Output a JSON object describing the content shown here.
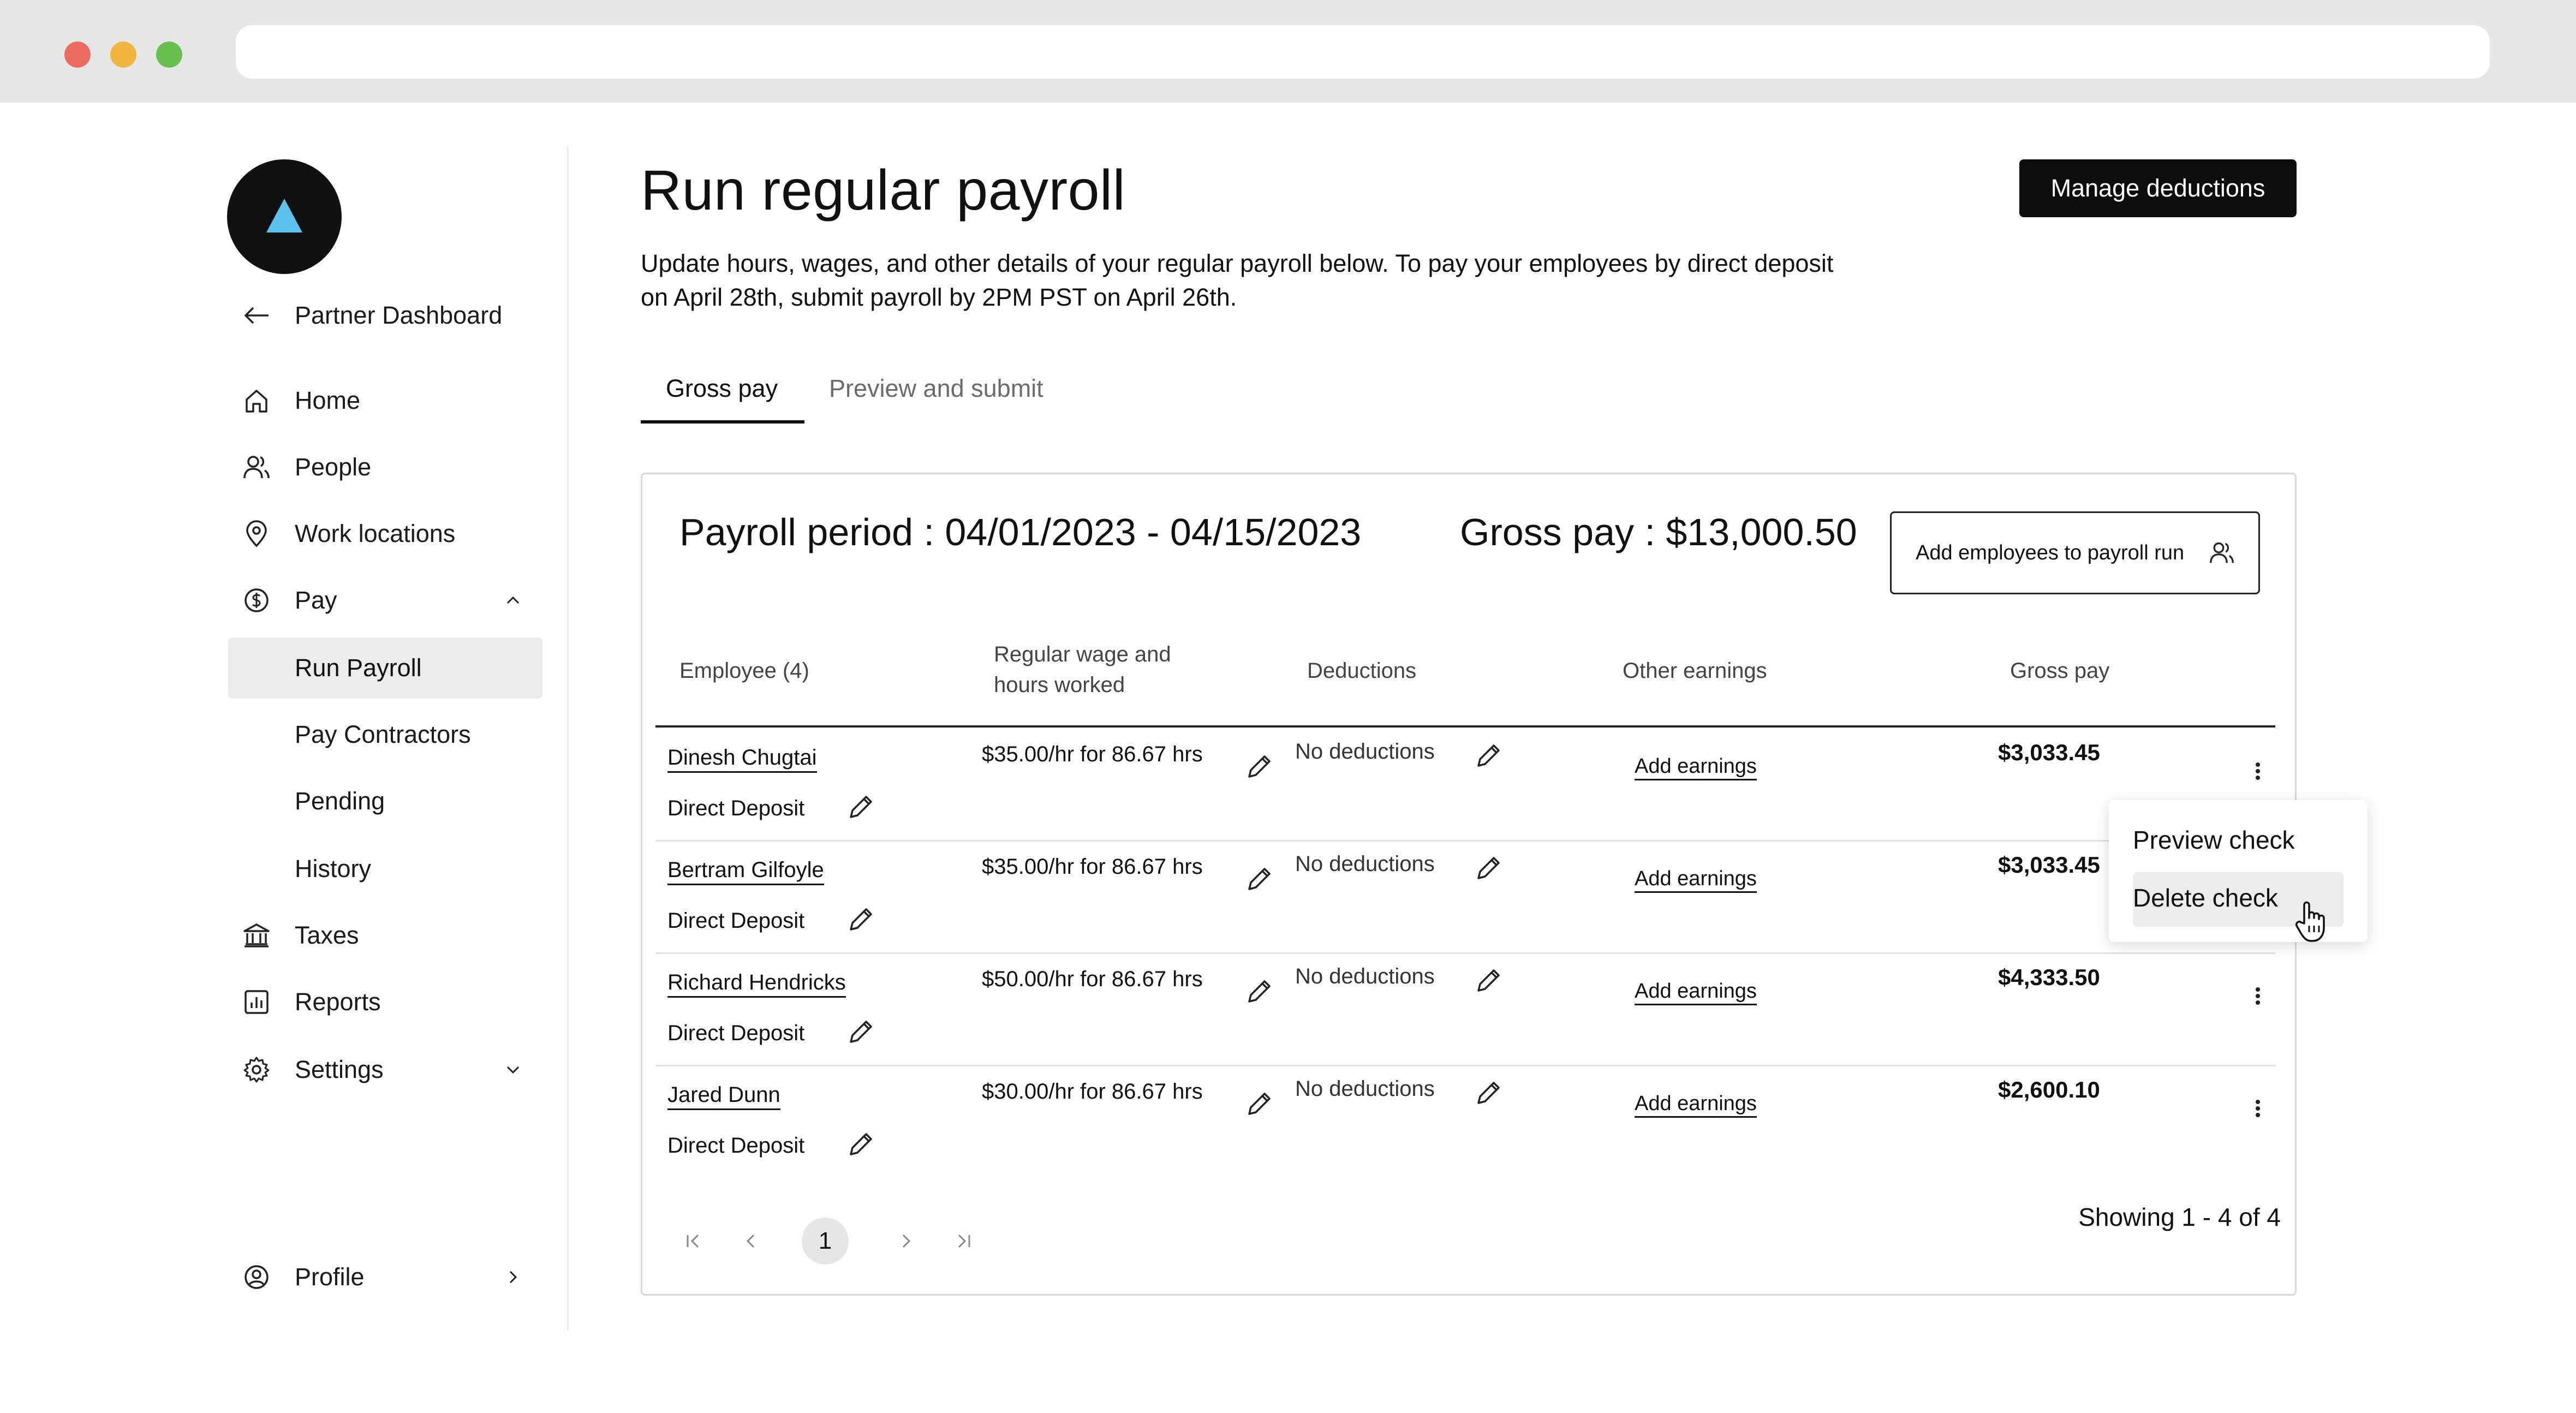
{
  "sidebar": {
    "back_link": "Partner Dashboard",
    "items": [
      {
        "label": "Home",
        "icon": "home-icon"
      },
      {
        "label": "People",
        "icon": "people-icon"
      },
      {
        "label": "Work locations",
        "icon": "location-pin-icon"
      },
      {
        "label": "Pay",
        "icon": "dollar-circle-icon"
      },
      {
        "label": "Run Payroll"
      },
      {
        "label": "Pay Contractors"
      },
      {
        "label": "Pending"
      },
      {
        "label": "History"
      },
      {
        "label": "Taxes",
        "icon": "bank-icon"
      },
      {
        "label": "Reports",
        "icon": "report-chart-icon"
      },
      {
        "label": "Settings",
        "icon": "gear-icon"
      }
    ],
    "profile": "Profile"
  },
  "header": {
    "title": "Run regular payroll",
    "subtitle": "Update hours, wages, and other details of your regular payroll below. To pay your employees by direct deposit on April 28th, submit payroll by 2PM PST on April 26th.",
    "manage_deductions": "Manage deductions"
  },
  "tabs": [
    {
      "label": "Gross pay",
      "active": true
    },
    {
      "label": "Preview and submit",
      "active": false
    }
  ],
  "card": {
    "period": "Payroll period : 04/01/2023 - 04/15/2023",
    "gross_total": "Gross pay : $13,000.50",
    "add_employees": "Add employees to payroll run",
    "columns": {
      "employee": "Employee (4)",
      "wage": "Regular wage and hours worked",
      "deductions": "Deductions",
      "earnings": "Other earnings",
      "gross": "Gross pay"
    },
    "rows": [
      {
        "name": "Dinesh Chugtai",
        "method": "Direct Deposit",
        "wage": "$35.00/hr for 86.67 hrs",
        "deductions": "No deductions",
        "earnings": "Add earnings",
        "gross": "$3,033.45"
      },
      {
        "name": "Bertram Gilfoyle",
        "method": "Direct Deposit",
        "wage": "$35.00/hr for 86.67 hrs",
        "deductions": "No deductions",
        "earnings": "Add earnings",
        "gross": "$3,033.45"
      },
      {
        "name": "Richard Hendricks",
        "method": "Direct Deposit",
        "wage": "$50.00/hr for 86.67 hrs",
        "deductions": "No deductions",
        "earnings": "Add earnings",
        "gross": "$4,333.50"
      },
      {
        "name": "Jared Dunn",
        "method": "Direct Deposit",
        "wage": "$30.00/hr for 86.67 hrs",
        "deductions": "No deductions",
        "earnings": "Add earnings",
        "gross": "$2,600.10"
      }
    ],
    "pagination": {
      "current": "1",
      "showing": "Showing 1 - 4 of 4"
    }
  },
  "menu": {
    "preview": "Preview check",
    "delete": "Delete check"
  }
}
